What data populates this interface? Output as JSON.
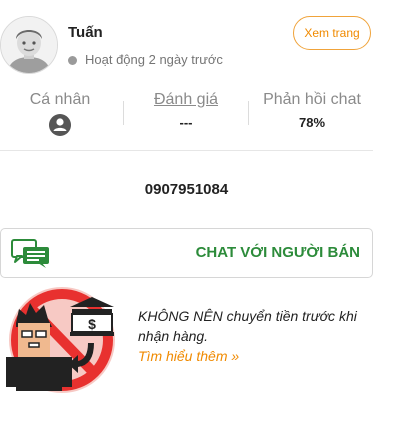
{
  "seller": {
    "name": "Tuấn",
    "status": "Hoạt động 2 ngày trước",
    "view_button": "Xem trang"
  },
  "stats": {
    "personal_label": "Cá nhân",
    "rating_label": "Đánh giá",
    "rating_value": "---",
    "reply_label": "Phản hồi chat",
    "reply_value": "78%"
  },
  "phone": "0907951084",
  "chat": {
    "label": "CHAT VỚI NGƯỜI BÁN",
    "icon": "chat-bubbles-icon"
  },
  "warning": {
    "text": "KHÔNG NÊN chuyển tiền trước khi nhận hàng.",
    "link": "Tìm hiểu thêm »",
    "icon": "no-prepayment-warning-icon"
  },
  "colors": {
    "accent_orange": "#f08a00",
    "chat_green": "#2c8b3a",
    "warning_red": "#e8312f"
  }
}
